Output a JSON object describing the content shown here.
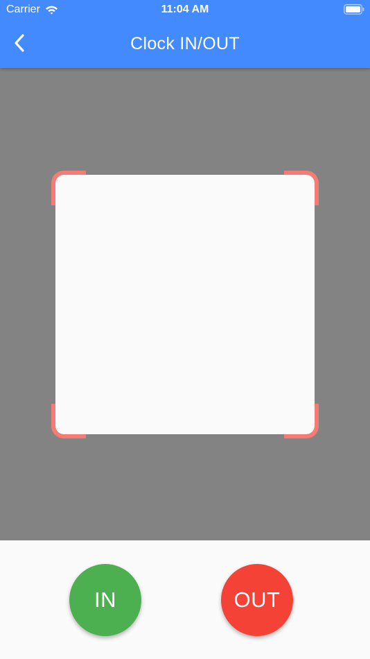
{
  "status_bar": {
    "carrier": "Carrier",
    "time": "11:04 AM",
    "icons": [
      "wifi-icon",
      "battery-icon"
    ]
  },
  "app_bar": {
    "title": "Clock IN/OUT",
    "back_icon": "chevron-left-icon"
  },
  "actions": {
    "in_label": "IN",
    "out_label": "OUT"
  },
  "colors": {
    "app_bar": "#448aff",
    "scanner_overlay": "#838383",
    "scan_corners": "#f47c74",
    "in_button": "#4caf50",
    "out_button": "#f44336",
    "panel_background": "#fafafa"
  }
}
